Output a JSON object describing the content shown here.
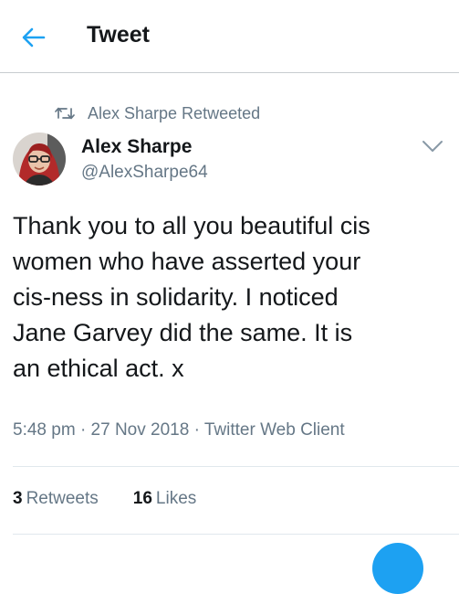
{
  "header": {
    "title": "Tweet",
    "back_icon": "arrow-left-icon"
  },
  "retweet": {
    "icon": "retweet-icon",
    "text": "Alex Sharpe Retweeted"
  },
  "author": {
    "name": "Alex Sharpe",
    "handle": "@AlexSharpe64"
  },
  "tweet": {
    "text": "Thank you to all you beautiful cis\nwomen who have asserted your\ncis-ness in solidarity. I noticed\nJane Garvey did the same. It is\nan ethical act. x",
    "time": "5:48 pm",
    "date": "27 Nov 2018",
    "client": "Twitter Web Client",
    "separator": "·"
  },
  "stats": {
    "retweets_count": "3",
    "retweets_label": "Retweets",
    "likes_count": "16",
    "likes_label": "Likes"
  },
  "colors": {
    "accent": "#1da1f2",
    "muted": "#657786",
    "text": "#14171a"
  }
}
